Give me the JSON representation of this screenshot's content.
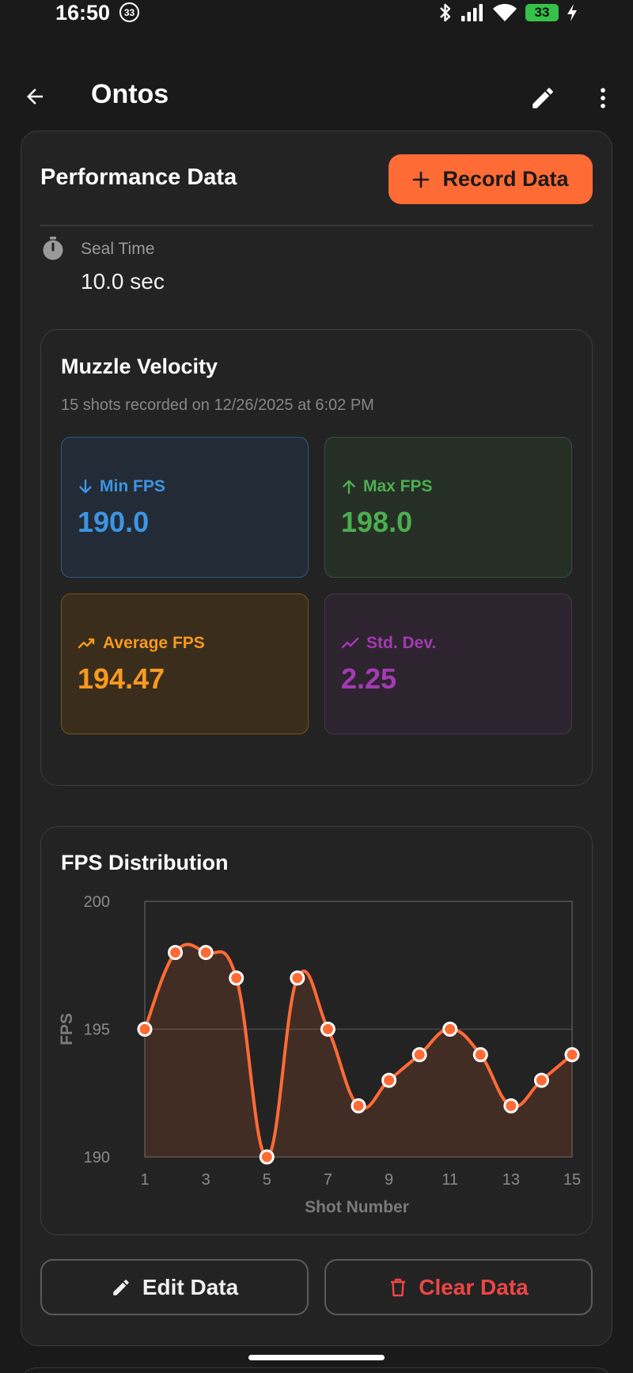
{
  "status_bar": {
    "time": "16:50",
    "notification_count": "33",
    "battery_level": "33",
    "icons": [
      "bluetooth-icon",
      "signal-icon",
      "wifi-icon",
      "battery-icon",
      "charging-icon"
    ]
  },
  "app_bar": {
    "title": "Ontos",
    "back_icon": "arrow-back-icon",
    "edit_icon": "pencil-icon",
    "more_icon": "more-vert-icon"
  },
  "performance": {
    "title": "Performance Data",
    "record_button": "Record Data",
    "seal_label": "Seal Time",
    "seal_value": "10.0 sec"
  },
  "muzzle_velocity": {
    "title": "Muzzle Velocity",
    "subtitle": "15 shots recorded on 12/26/2025 at 6:02 PM",
    "stats": {
      "min": {
        "label": "Min FPS",
        "value": "190.0",
        "color": "#3d94e3"
      },
      "max": {
        "label": "Max FPS",
        "value": "198.0",
        "color": "#4cae50"
      },
      "avg": {
        "label": "Average FPS",
        "value": "194.47",
        "color": "#f79a1f"
      },
      "std": {
        "label": "Std. Dev.",
        "value": "2.25",
        "color": "#a43ab3"
      }
    }
  },
  "chart_card": {
    "title": "FPS Distribution"
  },
  "chart_data": {
    "type": "line",
    "title": "FPS Distribution",
    "xlabel": "Shot Number",
    "ylabel": "FPS",
    "x": [
      1,
      2,
      3,
      4,
      5,
      6,
      7,
      8,
      9,
      10,
      11,
      12,
      13,
      14,
      15
    ],
    "values": [
      195,
      198,
      198,
      197,
      190,
      197,
      195,
      192,
      193,
      194,
      195,
      194,
      192,
      193,
      194
    ],
    "xlim": [
      1,
      15
    ],
    "ylim": [
      190,
      200
    ],
    "x_ticks": [
      1,
      3,
      5,
      7,
      9,
      11,
      13,
      15
    ],
    "y_ticks": [
      190,
      195,
      200
    ],
    "smooth": true,
    "filled": true,
    "line_color": "#ff6b35",
    "grid": true
  },
  "actions": {
    "edit_label": "Edit Data",
    "clear_label": "Clear Data",
    "clear_color": "#ef4545"
  }
}
